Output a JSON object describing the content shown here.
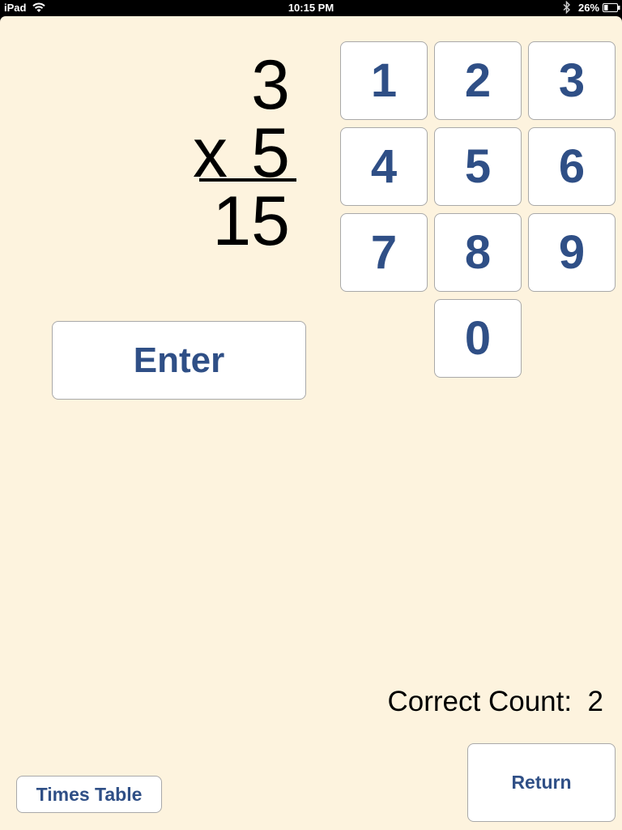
{
  "status_bar": {
    "carrier": "iPad",
    "time": "10:15 PM",
    "battery": "26%"
  },
  "problem": {
    "top_number": "3",
    "operator": "x",
    "bottom_number": "5",
    "answer": "15"
  },
  "keypad": {
    "keys": [
      "1",
      "2",
      "3",
      "4",
      "5",
      "6",
      "7",
      "8",
      "9",
      "0"
    ]
  },
  "enter_label": "Enter",
  "correct_count": {
    "label": "Correct Count:",
    "value": "2"
  },
  "times_table_label": "Times Table",
  "return_label": "Return",
  "colors": {
    "background": "#fdf3de",
    "button_text": "#2f4f86",
    "button_border": "#a9a9a9"
  }
}
